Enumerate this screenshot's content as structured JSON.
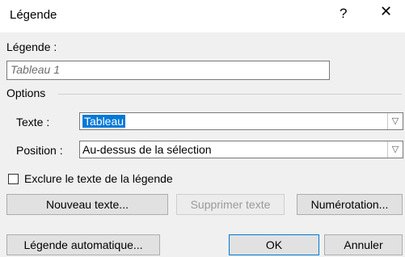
{
  "dialog": {
    "title": "Légende",
    "help": "?",
    "close": "✕"
  },
  "caption": {
    "label": "Légende :",
    "value": "Tableau 1"
  },
  "options": {
    "group_label": "Options",
    "texte_label": "Texte :",
    "texte_value": "Tableau",
    "position_label": "Position :",
    "position_value": "Au-dessus de la sélection",
    "exclude_label": "Exclure le texte de la légende"
  },
  "buttons": {
    "new_label": "Nouveau texte...",
    "delete_label": "Supprimer texte",
    "numbering_label": "Numérotation...",
    "auto_label": "Légende automatique...",
    "ok_label": "OK",
    "cancel_label": "Annuler"
  }
}
